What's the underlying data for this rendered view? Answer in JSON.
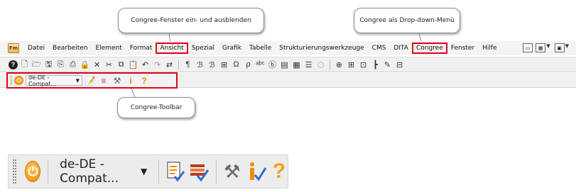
{
  "callouts": {
    "ansicht": "Congree-Fenster ein- und ausblenden",
    "congree_menu": "Congree als Drop-down-Menü",
    "toolbar": "Congree-Toolbar"
  },
  "app": {
    "logo": "Fm"
  },
  "menu": {
    "items": [
      "Datei",
      "Bearbeiten",
      "Element",
      "Format",
      "Ansicht",
      "Spezial",
      "Grafik",
      "Tabelle",
      "Strukturierungswerkzeuge",
      "CMS",
      "DITA",
      "Congree",
      "Fenster",
      "Hilfe"
    ],
    "highlighted": [
      "Ansicht",
      "Congree"
    ]
  },
  "toolbar_icons": [
    "help-icon",
    "new-file-icon",
    "open-icon",
    "save-icon",
    "save-as-icon",
    "print-icon",
    "lock-icon",
    "delete-icon",
    "cut-icon",
    "copy-icon",
    "paste-icon",
    "undo-icon",
    "redo-icon",
    "repeat-icon",
    "spellcheck-icon",
    "find-icon",
    "find-replace-icon",
    "link-icon",
    "tracking-icon",
    "thesaurus-icon",
    "insert-icon",
    "table-icon",
    "align-icon",
    "marker-icon",
    "element-icon",
    "graphic-icon",
    "format-icon",
    "list-icon",
    "update-icon"
  ],
  "congree": {
    "language_value": "de-DE - Compat...",
    "power_icon": "power-icon",
    "check_icon": "check-document-icon",
    "check_all_icon": "check-all-icon",
    "tools_icon": "tools-icon",
    "info_icon": "info-check-icon",
    "help_icon": "question-icon",
    "highlight_color": "#e3001b",
    "power_color": "#f5a11c"
  }
}
